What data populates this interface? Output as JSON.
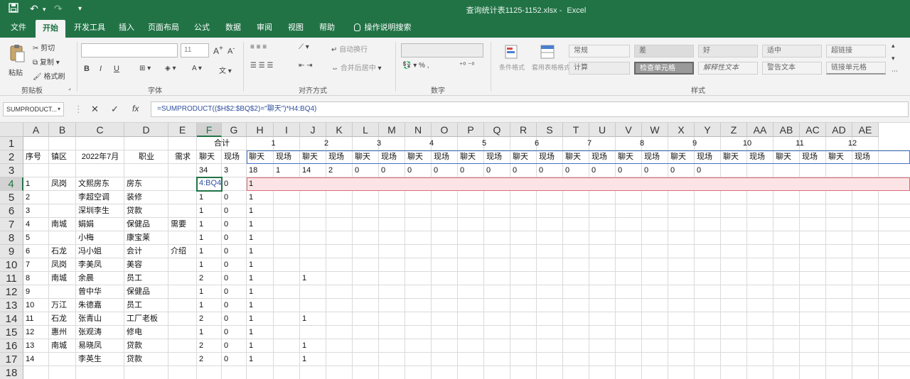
{
  "app": {
    "file_title": "查询统计表1125-1152.xlsx",
    "app_name": "Excel",
    "qat": {
      "save_icon": "save-icon",
      "undo_icon": "undo-icon",
      "redo_icon": "redo-icon"
    }
  },
  "tabs": [
    "文件",
    "开始",
    "开发工具",
    "插入",
    "页面布局",
    "公式",
    "数据",
    "审阅",
    "视图",
    "帮助",
    "操作说明搜索"
  ],
  "active_tab": "开始",
  "ribbon": {
    "groups": [
      "剪贴板",
      "字体",
      "对齐方式",
      "数字",
      "样式"
    ],
    "clipboard": {
      "paste": "粘贴",
      "cut": "剪切",
      "copy": "复制",
      "format_painter": "格式刷"
    },
    "font": {
      "font_name": "",
      "font_size": "11",
      "bold": "B",
      "italic": "I",
      "underline": "U"
    },
    "alignment": {
      "wrap_text": "自动换行",
      "merge_center": "合并后居中"
    },
    "styles": {
      "conditional_format": "条件格式",
      "format_table": "套用表格格式",
      "cells": [
        "常规",
        "差",
        "好",
        "适中",
        "超链接",
        "计算",
        "检查单元格",
        "解释性文本",
        "警告文本",
        "链接单元格"
      ]
    }
  },
  "formula_bar": {
    "name_box": "SUMPRODUCT...",
    "cancel": "✕",
    "confirm": "✓",
    "fx": "fx",
    "formula": "=SUMPRODUCT(($H$2:$BQ$2)=\"聊天\")*H4:BQ4)"
  },
  "sheet": {
    "columns": [
      "A",
      "B",
      "C",
      "D",
      "E",
      "F",
      "G",
      "H",
      "I",
      "J",
      "K",
      "L",
      "M",
      "N",
      "O",
      "P",
      "Q",
      "R",
      "S",
      "T",
      "U",
      "V",
      "W",
      "X",
      "Y",
      "Z",
      "AA",
      "AB",
      "AC",
      "AD",
      "AE"
    ],
    "selected_column": "F",
    "rows": [
      "1",
      "2",
      "3",
      "4",
      "5",
      "6",
      "7",
      "8",
      "9",
      "10",
      "11",
      "12",
      "13",
      "14",
      "15",
      "16",
      "17",
      "18"
    ],
    "selected_row": "4",
    "row1": {
      "total_label": "合计",
      "groups": [
        "1",
        "2",
        "3",
        "4",
        "5",
        "6",
        "7",
        "8",
        "9",
        "10",
        "11",
        "12"
      ]
    },
    "row2": {
      "A": "序号",
      "B": "镇区",
      "C": "2022年7月",
      "D": "职业",
      "E": "需求",
      "F": "聊天",
      "G": "现场",
      "pairs": [
        "聊天",
        "现场"
      ]
    },
    "row3": {
      "F": "34",
      "G": "3",
      "H_to_Y": [
        "18",
        "1",
        "14",
        "2",
        "0",
        "0",
        "0",
        "0",
        "0",
        "0",
        "0",
        "0",
        "0",
        "0",
        "0",
        "0",
        "0",
        "0"
      ]
    },
    "active_cell_text": "4:BQ4",
    "data_rows": [
      {
        "A": "1",
        "B": "凤岗",
        "C": "文熙房东",
        "D": "房东",
        "E": "",
        "F": "",
        "G": "0",
        "H": "1",
        "J": ""
      },
      {
        "A": "2",
        "B": "",
        "C": "李超空调",
        "D": "装修",
        "E": "",
        "F": "1",
        "G": "0",
        "H": "1",
        "J": ""
      },
      {
        "A": "3",
        "B": "",
        "C": "深圳李生",
        "D": "贷款",
        "E": "",
        "F": "1",
        "G": "0",
        "H": "1",
        "J": ""
      },
      {
        "A": "4",
        "B": "南城",
        "C": "娟娟",
        "D": "保健品",
        "E": "需要",
        "F": "1",
        "G": "0",
        "H": "1",
        "J": ""
      },
      {
        "A": "5",
        "B": "",
        "C": "小梅",
        "D": "康宝莱",
        "E": "",
        "F": "1",
        "G": "0",
        "H": "1",
        "J": ""
      },
      {
        "A": "6",
        "B": "石龙",
        "C": "冯小姐",
        "D": "会计",
        "E": "介绍",
        "F": "1",
        "G": "0",
        "H": "1",
        "J": ""
      },
      {
        "A": "7",
        "B": "凤岗",
        "C": "李美凤",
        "D": "美容",
        "E": "",
        "F": "1",
        "G": "0",
        "H": "1",
        "J": ""
      },
      {
        "A": "8",
        "B": "南城",
        "C": "余晨",
        "D": "员工",
        "E": "",
        "F": "2",
        "G": "0",
        "H": "1",
        "J": "1"
      },
      {
        "A": "9",
        "B": "",
        "C": "曾中华",
        "D": "保健品",
        "E": "",
        "F": "1",
        "G": "0",
        "H": "1",
        "J": ""
      },
      {
        "A": "10",
        "B": "万江",
        "C": "朱德嘉",
        "D": "员工",
        "E": "",
        "F": "1",
        "G": "0",
        "H": "1",
        "J": ""
      },
      {
        "A": "11",
        "B": "石龙",
        "C": "张青山",
        "D": "工厂老板",
        "E": "",
        "F": "2",
        "G": "0",
        "H": "1",
        "J": "1"
      },
      {
        "A": "12",
        "B": "惠州",
        "C": "张观涛",
        "D": "修电",
        "E": "",
        "F": "1",
        "G": "0",
        "H": "1",
        "J": ""
      },
      {
        "A": "13",
        "B": "南城",
        "C": "易晓凤",
        "D": "贷款",
        "E": "",
        "F": "2",
        "G": "0",
        "H": "1",
        "J": "1"
      },
      {
        "A": "14",
        "B": "",
        "C": "李英生",
        "D": "贷款",
        "E": "",
        "F": "2",
        "G": "0",
        "H": "1",
        "J": "1"
      }
    ]
  },
  "colors": {
    "excel_green": "#217346",
    "selection_pink": "#fbe3e6",
    "range_blue": "#4472c4",
    "formula_text": "#2f4f9e"
  }
}
